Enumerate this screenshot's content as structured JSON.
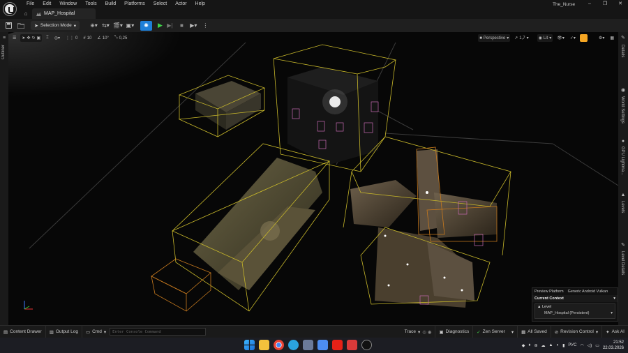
{
  "menu": [
    "File",
    "Edit",
    "Window",
    "Tools",
    "Build",
    "Platforms",
    "Select",
    "Actor",
    "Help"
  ],
  "level_tab": "MAP_Hospital",
  "project_name": "The_Nurse",
  "window_controls": [
    "–",
    "❐",
    "✕"
  ],
  "toolbar": {
    "selection_mode": "Selection Mode"
  },
  "left_panel": {
    "outliner": "Outliner"
  },
  "right_panel": {
    "details": "Details",
    "world_settings": "World Settings",
    "gpu_lightmass": "GPU Lightma...",
    "levels": "Levels",
    "level_details": "Level Details"
  },
  "viewport": {
    "perspective": "Perspective",
    "camera_speed": "1,7",
    "view_mode": "Lit",
    "grid_snap": "0",
    "grid_size": "10",
    "rotation_snap": "10°",
    "scale_snap": "0,25"
  },
  "context_panel": {
    "preview_platform_label": "Preview Platform",
    "preview_platform_value": "Generic Android Vulkan",
    "current_context": "Current Context",
    "level_label": "Level",
    "level_value": "MAP_Hospital (Persistent)"
  },
  "bottom_bar": {
    "content_drawer": "Content Drawer",
    "output_log": "Output Log",
    "cmd": "Cmd",
    "console_placeholder": "Enter Console Command",
    "trace": "Trace",
    "diagnostics": "Diagnostics",
    "zen_server": "Zen Server",
    "all_saved": "All Saved",
    "revision_control": "Revision Control",
    "ask_ai": "Ask AI"
  },
  "taskbar": {
    "language": "РУС",
    "time": "21:52",
    "date": "22.03.2026"
  },
  "colors": {
    "play_blue": "#1e7fd8",
    "play_green": "#3fd44a",
    "snap_yellow": "#f5a623",
    "volume_yellow": "#c8b82a",
    "volume_orange": "#c87a1e",
    "volume_pink": "#c86ab4"
  }
}
